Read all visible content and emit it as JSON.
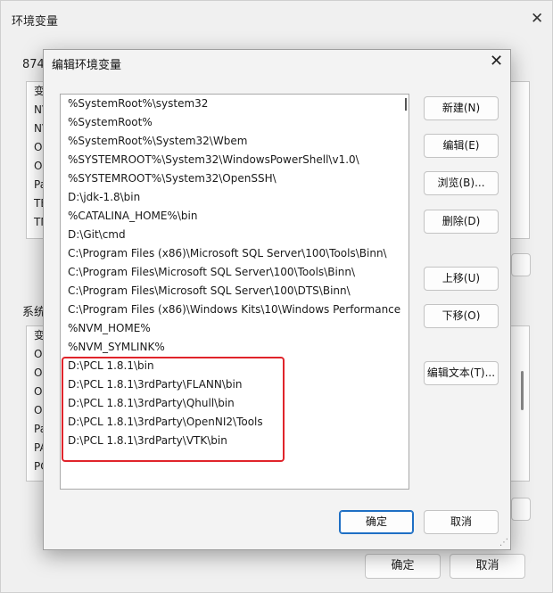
{
  "background_window": {
    "title": "环境变量",
    "user_group_label": "874",
    "user_list_header": "变",
    "user_rows": [
      "NV",
      "NV",
      "On",
      "On",
      "Pa",
      "TE",
      "TM"
    ],
    "system_group_label": "系统",
    "system_list_header": "变",
    "system_rows": [
      "OF",
      "OF",
      "OF",
      "Os",
      "Pa",
      "PA",
      "PC"
    ],
    "ok_label": "确定",
    "cancel_label": "取消"
  },
  "dialog": {
    "title": "编辑环境变量",
    "paths": [
      "%SystemRoot%\\system32",
      "%SystemRoot%",
      "%SystemRoot%\\System32\\Wbem",
      "%SYSTEMROOT%\\System32\\WindowsPowerShell\\v1.0\\",
      "%SYSTEMROOT%\\System32\\OpenSSH\\",
      "D:\\jdk-1.8\\bin",
      "%CATALINA_HOME%\\bin",
      "D:\\Git\\cmd",
      "C:\\Program Files (x86)\\Microsoft SQL Server\\100\\Tools\\Binn\\",
      "C:\\Program Files\\Microsoft SQL Server\\100\\Tools\\Binn\\",
      "C:\\Program Files\\Microsoft SQL Server\\100\\DTS\\Binn\\",
      "C:\\Program Files (x86)\\Windows Kits\\10\\Windows Performance",
      "%NVM_HOME%",
      "%NVM_SYMLINK%",
      "D:\\PCL 1.8.1\\bin",
      "D:\\PCL 1.8.1\\3rdParty\\FLANN\\bin",
      "D:\\PCL 1.8.1\\3rdParty\\Qhull\\bin",
      "D:\\PCL 1.8.1\\3rdParty\\OpenNI2\\Tools",
      "D:\\PCL 1.8.1\\3rdParty\\VTK\\bin"
    ],
    "buttons": {
      "new": "新建(N)",
      "edit": "编辑(E)",
      "browse": "浏览(B)...",
      "delete": "删除(D)",
      "move_up": "上移(U)",
      "move_down": "下移(O)",
      "edit_text": "编辑文本(T)..."
    },
    "ok_label": "确定",
    "cancel_label": "取消",
    "highlight_color": "#e0242b"
  }
}
